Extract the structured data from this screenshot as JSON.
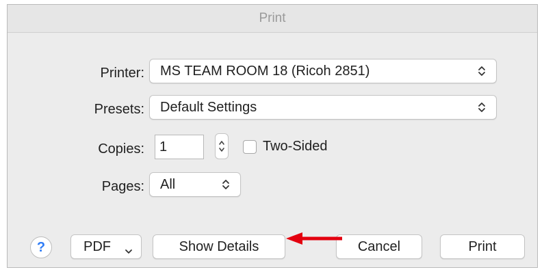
{
  "window": {
    "title": "Print"
  },
  "printer": {
    "label": "Printer:",
    "value": "MS TEAM ROOM 18 (Ricoh 2851)"
  },
  "presets": {
    "label": "Presets:",
    "value": "Default Settings"
  },
  "copies": {
    "label": "Copies:",
    "value": "1"
  },
  "two_sided": {
    "label": "Two-Sided",
    "checked": false
  },
  "pages": {
    "label": "Pages:",
    "value": "All"
  },
  "footer": {
    "help_label": "?",
    "pdf_label": "PDF",
    "show_details_label": "Show Details",
    "cancel_label": "Cancel",
    "print_label": "Print"
  },
  "annotation": {
    "color": "#e3000f",
    "points_to": "show-details-button"
  },
  "icons": {
    "popup_arrows": "up-down-chevron-icon",
    "pdf_dropdown": "chevron-down-icon",
    "copies_stepper": "stepper-icon"
  },
  "colors": {
    "accent": "#2e7cf6",
    "annotation": "#e3000f"
  }
}
